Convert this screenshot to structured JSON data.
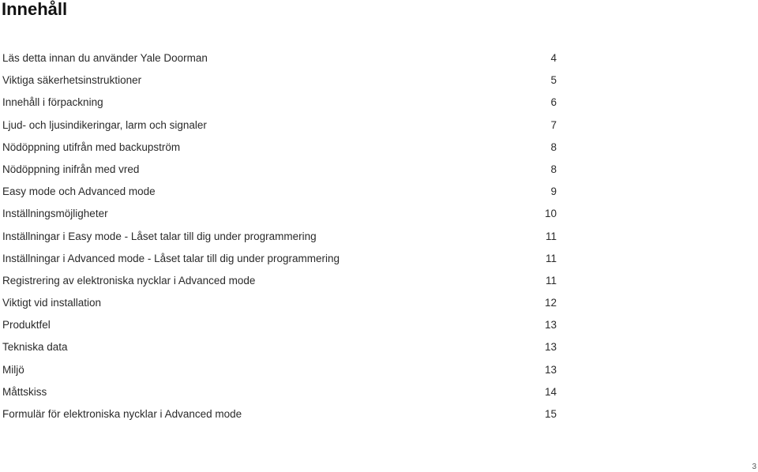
{
  "header": {
    "title": "Innehåll"
  },
  "toc": {
    "entries": [
      {
        "title": "Läs detta innan du använder Yale Doorman",
        "page": "4"
      },
      {
        "title": "Viktiga säkerhetsinstruktioner",
        "page": "5"
      },
      {
        "title": "Innehåll i förpackning",
        "page": "6"
      },
      {
        "title": "Ljud- och ljusindikeringar, larm och signaler",
        "page": "7"
      },
      {
        "title": "Nödöppning utifrån med backupström",
        "page": "8"
      },
      {
        "title": "Nödöppning inifrån med vred",
        "page": "8"
      },
      {
        "title": "Easy mode och Advanced mode",
        "page": "9"
      },
      {
        "title": "Inställningsmöjligheter",
        "page": "10"
      },
      {
        "title": "Inställningar i Easy mode - Låset talar till dig under programmering",
        "page": "11"
      },
      {
        "title": "Inställningar i Advanced mode - Låset talar till dig under programmering",
        "page": "11"
      },
      {
        "title": "Registrering av elektroniska nycklar i Advanced mode",
        "page": "11"
      },
      {
        "title": "Viktigt vid installation",
        "page": "12"
      },
      {
        "title": "Produktfel",
        "page": "13"
      },
      {
        "title": "Tekniska data",
        "page": "13"
      },
      {
        "title": "Miljö",
        "page": "13"
      },
      {
        "title": "Måttskiss",
        "page": "14"
      },
      {
        "title": "Formulär för elektroniska nycklar i Advanced mode",
        "page": "15"
      }
    ]
  },
  "footer": {
    "page_number": "3"
  }
}
